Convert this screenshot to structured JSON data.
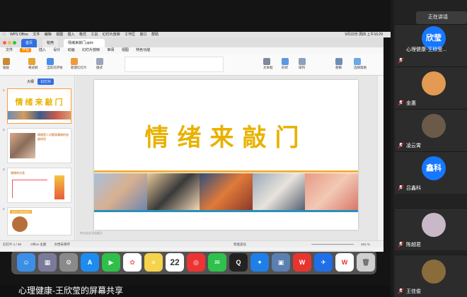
{
  "meeting": {
    "speaking_label": "正在讲话",
    "bottom_caption": "心理健康-王欣莹的屏幕共享",
    "participants": [
      {
        "name": "心理健康-王欣莹...",
        "avatar_text": "欣莹",
        "color": "#1677ff"
      },
      {
        "name": "金惠",
        "avatar_text": "",
        "color": "#e39a52"
      },
      {
        "name": "凌云霄",
        "avatar_text": "",
        "color": "#6b5a4a"
      },
      {
        "name": "吕鑫科",
        "avatar_text": "鑫科",
        "color": "#1677ff"
      },
      {
        "name": "陈越君",
        "avatar_text": "",
        "color": "#c9b8c8"
      },
      {
        "name": "王佳俊",
        "avatar_text": "",
        "color": "#8a6b3a"
      }
    ]
  },
  "mac_menubar": {
    "items": [
      "WPS Office",
      "文件",
      "编辑",
      "视图",
      "插入",
      "格式",
      "工具",
      "幻灯片放映",
      "工作区",
      "窗口",
      "帮助"
    ],
    "clock": "9月22日 周四 上午10:29"
  },
  "wps": {
    "tabs": [
      "首页",
      "稻壳",
      "情绪来敲门.pptx"
    ],
    "ribbon_menu": [
      "文件",
      "开始",
      "插入",
      "设计",
      "动画",
      "幻灯片放映",
      "审阅",
      "视图",
      "特色功能"
    ],
    "ribbon_active": "开始",
    "toolbar": [
      {
        "label": "粘贴",
        "icon": "paste-icon"
      },
      {
        "label": "格式刷",
        "icon": "format-painter-icon"
      },
      {
        "label": "当前页开始",
        "icon": "play-icon"
      },
      {
        "label": "新建幻灯片",
        "icon": "new-slide-icon"
      },
      {
        "label": "版式",
        "icon": "layout-icon"
      },
      {
        "label": "文本框",
        "icon": "textbox-icon"
      },
      {
        "label": "形状",
        "icon": "shape-icon"
      },
      {
        "label": "排列",
        "icon": "arrange-icon"
      },
      {
        "label": "替换",
        "icon": "replace-icon"
      },
      {
        "label": "选择窗格",
        "icon": "selection-pane-icon"
      }
    ],
    "pane_tabs": [
      "大纲",
      "幻灯片"
    ],
    "slide_title": "情绪来敲门",
    "notes_placeholder": "单击此处添加备注",
    "status": {
      "slide_counter": "幻灯片 1 / 30",
      "theme": "Office 主题",
      "backup": "文档未保存",
      "zoom": "101 %",
      "smart_beautify": "智能美化"
    },
    "thumbs": [
      {
        "no": "1",
        "title": "情绪来敲门"
      },
      {
        "no": "2",
        "text": "情绪是人对客观事物的态度体验"
      },
      {
        "no": "3",
        "text": "情绪的分类"
      },
      {
        "no": "4",
        "text": "TEST WORDS"
      }
    ]
  },
  "dock": {
    "date_number": "22",
    "apps": [
      "finder",
      "launchpad",
      "system-preferences",
      "app-store",
      "facetime",
      "photos",
      "notes",
      "calendar",
      "netease-music",
      "wechat",
      "qq",
      "safari",
      "preview",
      "wps-office",
      "lark",
      "wps-writer",
      "trash"
    ]
  }
}
